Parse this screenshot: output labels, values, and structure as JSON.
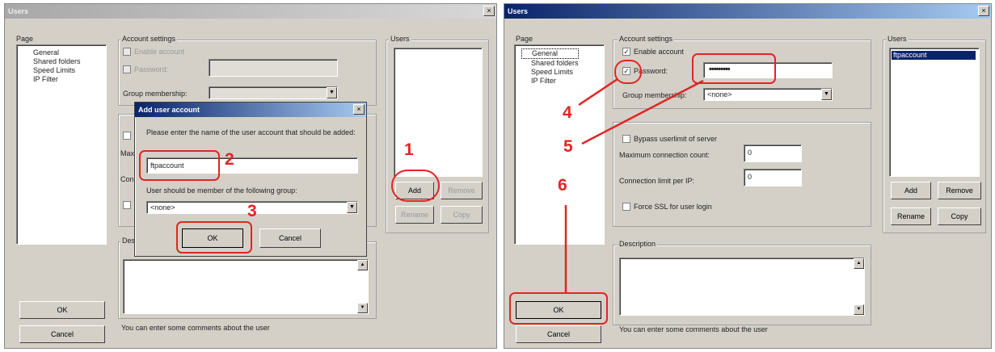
{
  "left": {
    "title": "Users",
    "page_label": "Page",
    "tree": [
      "General",
      "Shared folders",
      "Speed Limits",
      "IP Filter"
    ],
    "account_settings_label": "Account settings",
    "enable_account": "Enable account",
    "password": "Password:",
    "group_membership": "Group membership:",
    "users_label": "Users",
    "add": "Add",
    "remove": "Remove",
    "rename": "Rename",
    "copy": "Copy",
    "desc_label": "Des",
    "comment": "You can enter some comments about the user",
    "ok": "OK",
    "cancel": "Cancel",
    "behind_max": "Max",
    "behind_con": "Con"
  },
  "dialog": {
    "title": "Add user account",
    "prompt": "Please enter the name of the user account that should be added:",
    "name_value": "ftpaccount",
    "group_prompt": "User should be member of the following group:",
    "group_value": "<none>",
    "ok": "OK",
    "cancel": "Cancel"
  },
  "right": {
    "title": "Users",
    "page_label": "Page",
    "tree": [
      "General",
      "Shared folders",
      "Speed Limits",
      "IP Filter"
    ],
    "account_settings_label": "Account settings",
    "enable_account": "Enable account",
    "password": "Password:",
    "password_value": "•••••••••",
    "group_membership": "Group membership:",
    "group_value": "<none>",
    "bypass": "Bypass userlimit of server",
    "max_conn": "Maximum connection count:",
    "max_conn_value": "0",
    "conn_limit": "Connection limit per IP:",
    "conn_limit_value": "0",
    "force_ssl": "Force SSL for user login",
    "users_label": "Users",
    "user_item": "ftpaccount",
    "add": "Add",
    "remove": "Remove",
    "rename": "Rename",
    "copy": "Copy",
    "desc_label": "Description",
    "comment": "You can enter some comments about the user",
    "ok": "OK",
    "cancel": "Cancel"
  },
  "steps": [
    "1",
    "2",
    "3",
    "4",
    "5",
    "6"
  ],
  "colors": {
    "annotation": "#e32424",
    "active_title": "#0a246a",
    "dialog_bg": "#d4d0c8"
  }
}
